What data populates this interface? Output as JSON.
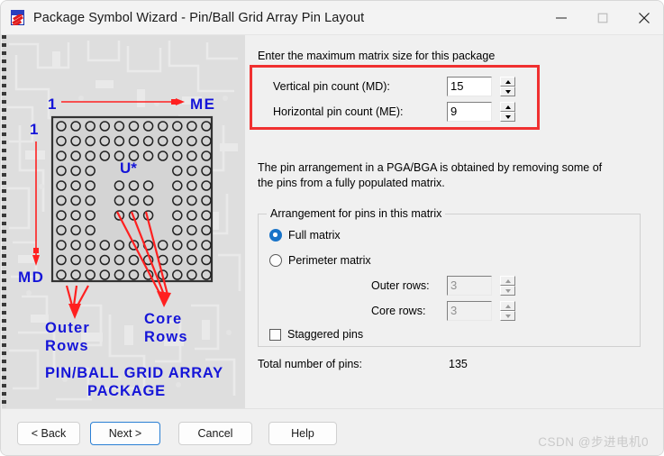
{
  "window": {
    "title": "Package Symbol Wizard - Pin/Ball Grid Array Pin Layout",
    "app_icon": "document-lightning-icon",
    "controls": {
      "minimize": "minimize-icon",
      "maximize": "maximize-icon",
      "close": "close-icon"
    }
  },
  "illustration": {
    "label_me": "ME",
    "label_md": "MD",
    "label_top_one": "1",
    "label_left_one": "1",
    "label_chip": "U*",
    "label_outer_rows_line1": "Outer",
    "label_outer_rows_line2": "Rows",
    "label_core_rows_line1": "Core",
    "label_core_rows_line2": "Rows",
    "caption_line1": "PIN/BALL GRID ARRAY",
    "caption_line2": "PACKAGE",
    "colors": {
      "annotation_blue": "#1515d8",
      "annotation_red": "#ff2020",
      "board_fill": "#d4d4d4",
      "board_stroke": "#333333",
      "background": "#dedede"
    },
    "grid": {
      "columns": 11,
      "rows": 11,
      "core_hole_cols": 5,
      "core_hole_rows": 5
    }
  },
  "content": {
    "intro": "Enter the maximum matrix size for this package",
    "fields": [
      {
        "label": "Vertical pin count (MD):",
        "value": "15",
        "enabled": true
      },
      {
        "label": "Horizontal pin count (ME):",
        "value": "9",
        "enabled": true
      }
    ],
    "description_line1": "The pin arrangement in a PGA/BGA is obtained by removing some of",
    "description_line2": "the pins from a fully populated matrix.",
    "group": {
      "title": "Arrangement for pins in this matrix",
      "radios": [
        {
          "label": "Full matrix",
          "checked": true
        },
        {
          "label": "Perimeter matrix",
          "checked": false
        }
      ],
      "sub_fields": [
        {
          "label": "Outer rows:",
          "value": "3",
          "enabled": false
        },
        {
          "label": "Core rows:",
          "value": "3",
          "enabled": false
        }
      ],
      "checkbox": {
        "label": "Staggered pins",
        "checked": false
      }
    },
    "total_label": "Total number of pins:",
    "total_value": "135",
    "highlight_color": "#f03030"
  },
  "buttons": [
    {
      "label": "< Back",
      "focused": false
    },
    {
      "label": "Next >",
      "focused": true
    },
    {
      "label": "Cancel",
      "focused": false
    },
    {
      "label": "Help",
      "focused": false
    }
  ],
  "watermark": "CSDN @步进电机0"
}
